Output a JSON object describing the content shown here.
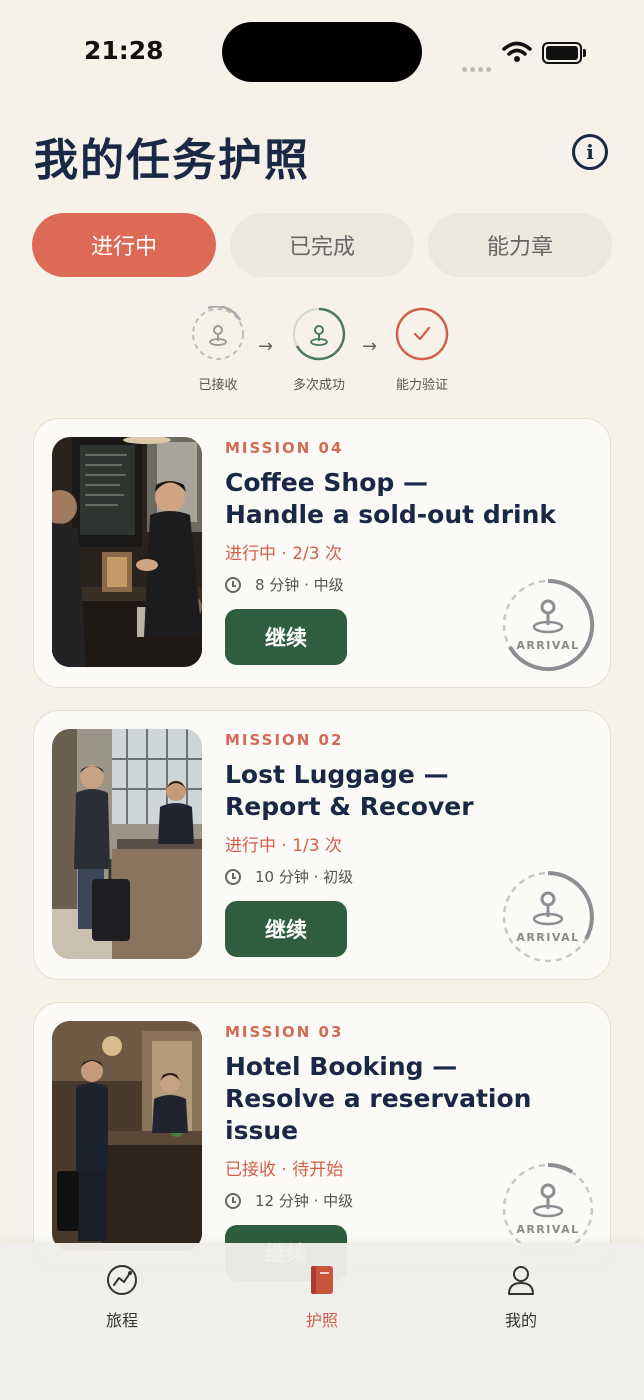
{
  "status_bar": {
    "time": "21:28"
  },
  "header": {
    "title": "我的任务护照",
    "info_icon": "info-icon"
  },
  "tabs": [
    {
      "label": "进行中",
      "active": true
    },
    {
      "label": "已完成",
      "active": false
    },
    {
      "label": "能力章",
      "active": false
    }
  ],
  "steps": [
    {
      "label": "已接收",
      "icon": "pin-icon"
    },
    {
      "label": "多次成功",
      "icon": "pin-icon"
    },
    {
      "label": "能力验证",
      "icon": "check-icon"
    }
  ],
  "missions": [
    {
      "number": "MISSION 04",
      "title_line1": "Coffee Shop —",
      "title_line2": "Handle a sold-out drink",
      "status": "进行中 · 2/3 次",
      "meta": "8 分钟 · 中级",
      "button": "继续",
      "badge": "ARRIVAL",
      "progress": 0.6667
    },
    {
      "number": "MISSION 02",
      "title_line1": "Lost Luggage —",
      "title_line2": "Report & Recover",
      "status": "进行中 · 1/3 次",
      "meta": "10 分钟 · 初级",
      "button": "继续",
      "badge": "ARRIVAL",
      "progress": 0.3333
    },
    {
      "number": "MISSION 03",
      "title_line1": "Hotel Booking —",
      "title_line2": "Resolve a reservation issue",
      "status": "已接收 · 待开始",
      "meta": "12 分钟 · 中级",
      "button": "继续",
      "badge": "ARRIVAL",
      "progress": 0.1
    }
  ],
  "tabbar": [
    {
      "label": "旅程",
      "icon": "journey-icon",
      "active": false
    },
    {
      "label": "护照",
      "icon": "passport-icon",
      "active": true
    },
    {
      "label": "我的",
      "icon": "profile-icon",
      "active": false
    }
  ],
  "colors": {
    "accent": "#dd6a55",
    "primary_button": "#2e5e3e",
    "title": "#1a2745",
    "background": "#f6f2ea"
  }
}
